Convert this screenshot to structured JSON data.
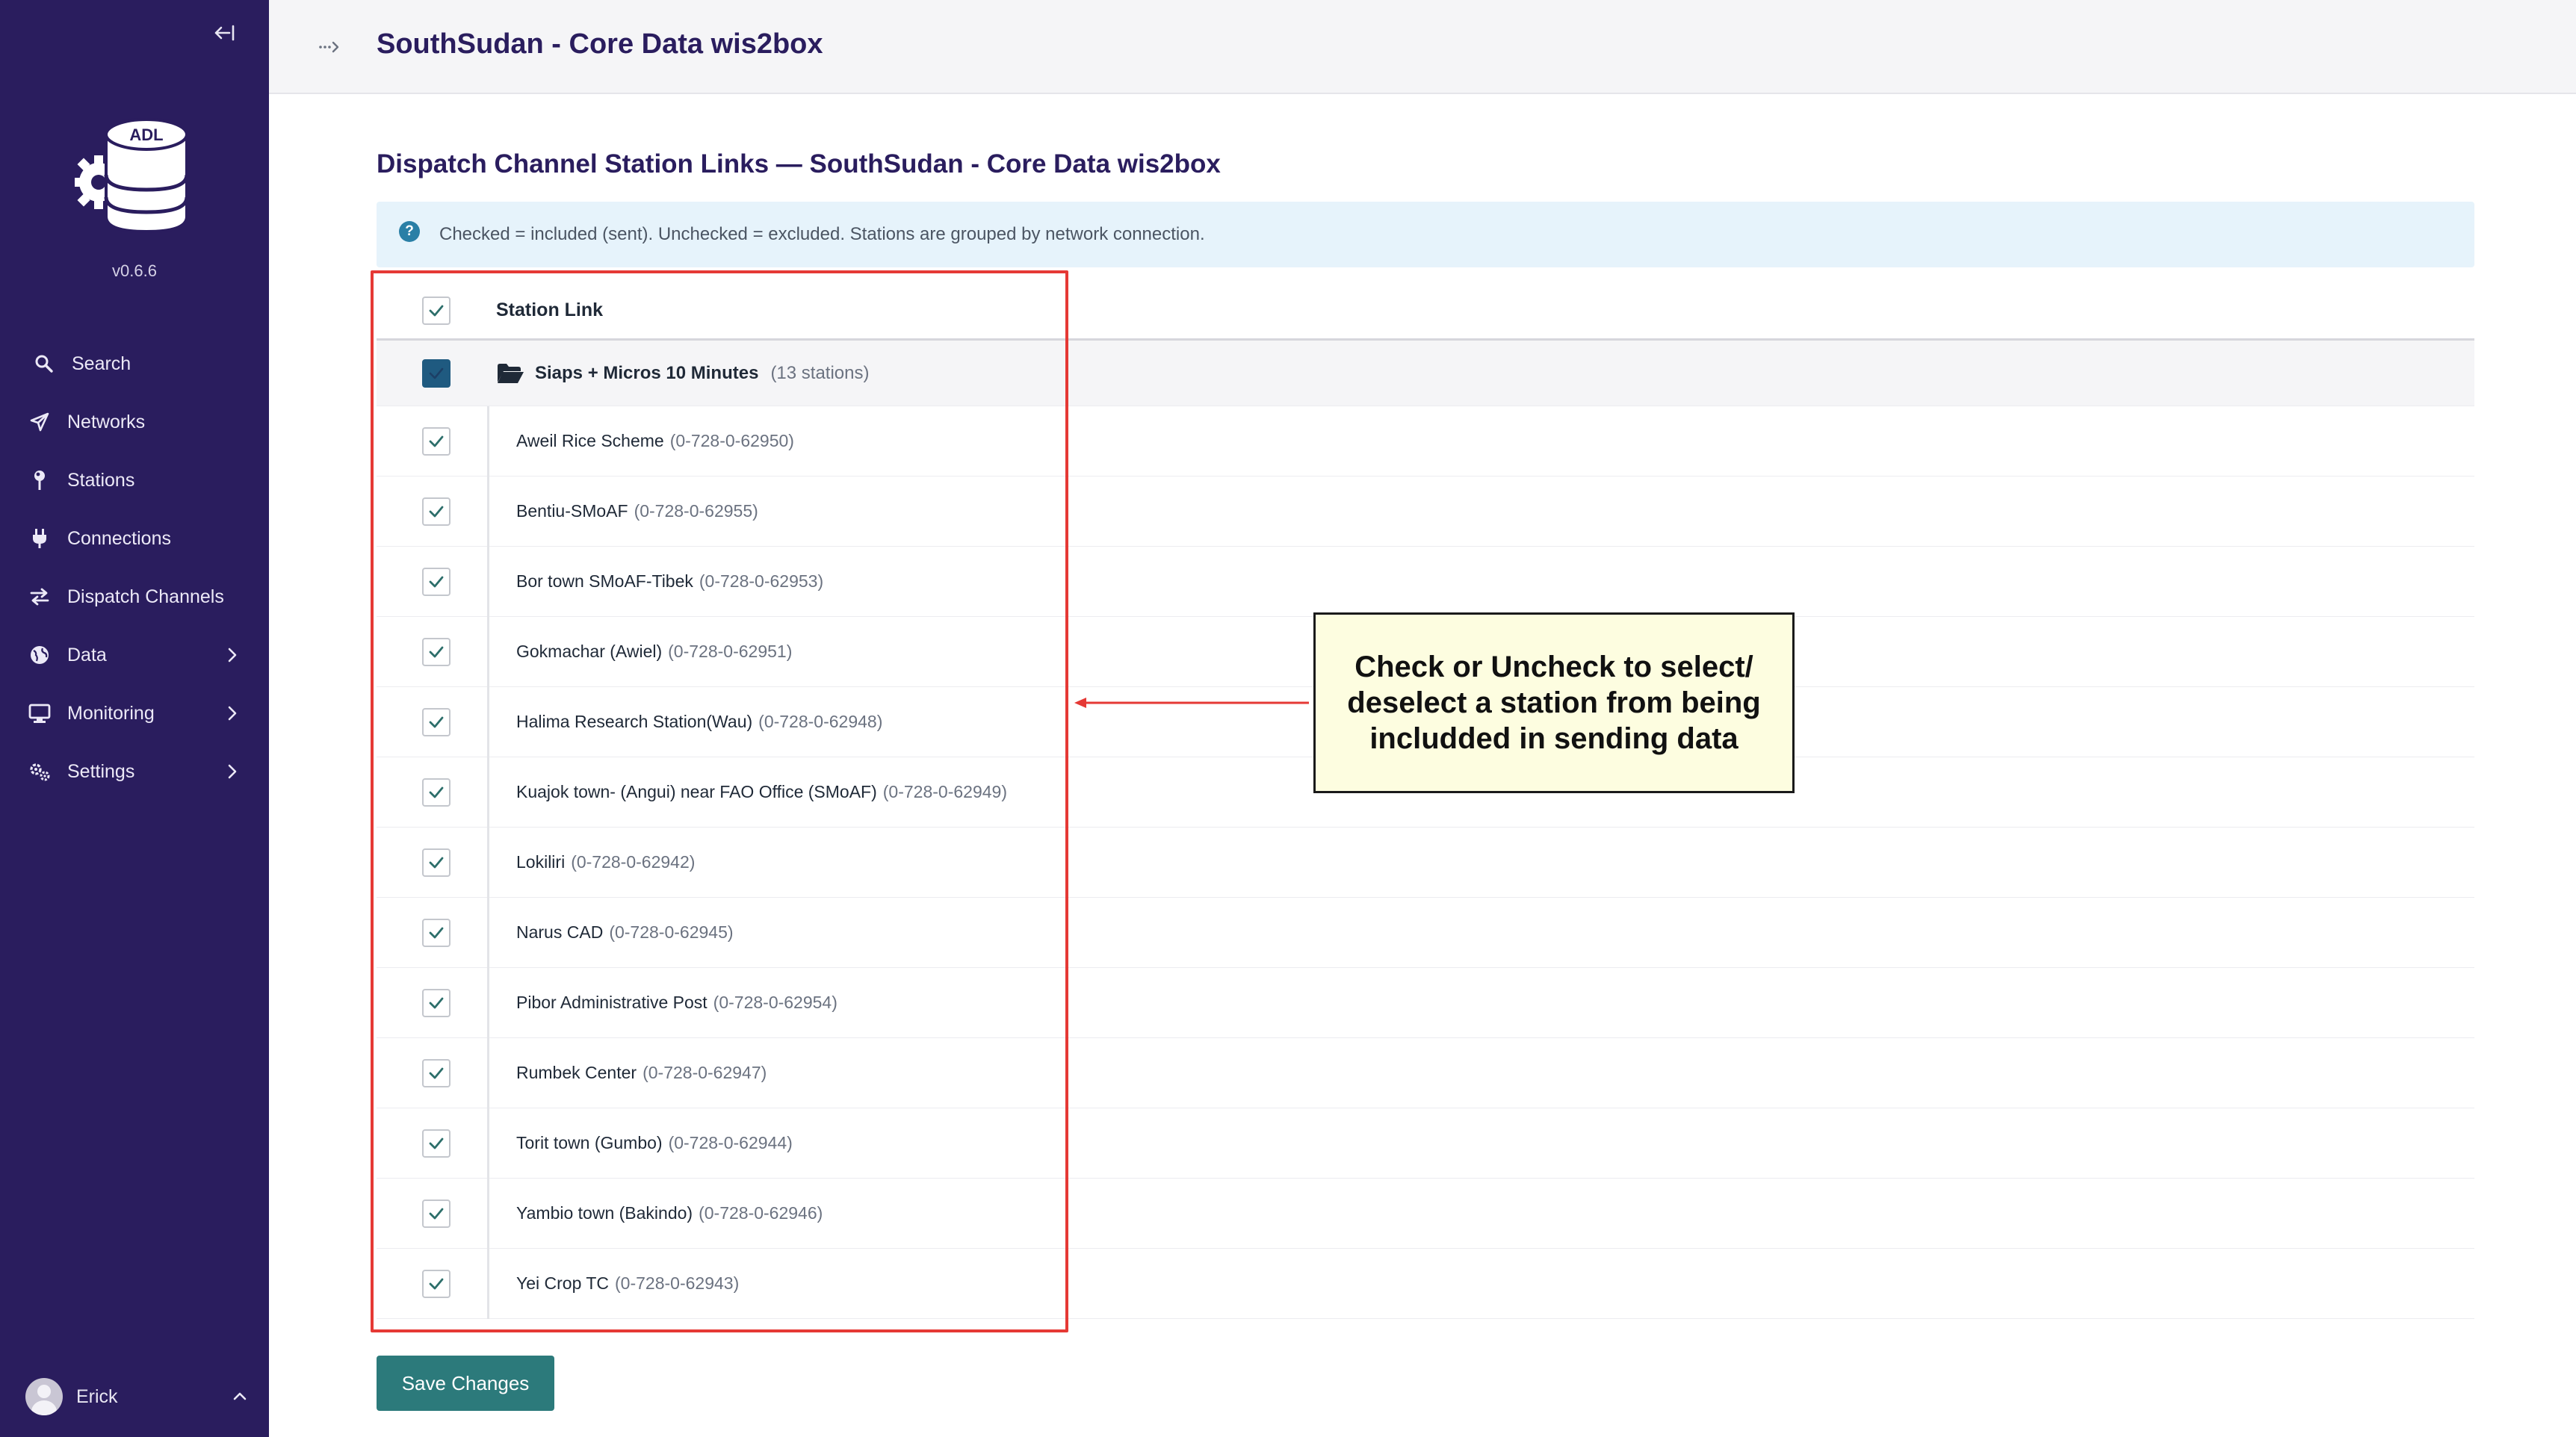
{
  "app": {
    "logo_text": "ADL",
    "version": "v0.6.6"
  },
  "sidebar": {
    "items": [
      {
        "label": "Search",
        "icon": "search-icon",
        "has_submenu": false
      },
      {
        "label": "Networks",
        "icon": "send-icon",
        "has_submenu": false
      },
      {
        "label": "Stations",
        "icon": "pin-icon",
        "has_submenu": false
      },
      {
        "label": "Connections",
        "icon": "plug-icon",
        "has_submenu": false
      },
      {
        "label": "Dispatch Channels",
        "icon": "swap-icon",
        "has_submenu": false
      },
      {
        "label": "Data",
        "icon": "globe-icon",
        "has_submenu": true
      },
      {
        "label": "Monitoring",
        "icon": "monitor-icon",
        "has_submenu": true
      },
      {
        "label": "Settings",
        "icon": "cogs-icon",
        "has_submenu": true
      }
    ],
    "user": {
      "name": "Erick"
    }
  },
  "header": {
    "title": "SouthSudan - Core Data wis2box"
  },
  "main": {
    "title": "Dispatch Channel Station Links — SouthSudan - Core Data wis2box",
    "info": "Checked = included (sent). Unchecked = excluded. Stations are grouped by network connection.",
    "table": {
      "column_header": "Station Link",
      "group": {
        "name": "Siaps + Micros 10 Minutes",
        "count": "(13 stations)",
        "checked": true
      },
      "stations": [
        {
          "name": "Aweil Rice Scheme",
          "id": "(0-728-0-62950)",
          "checked": true
        },
        {
          "name": "Bentiu-SMoAF",
          "id": "(0-728-0-62955)",
          "checked": true
        },
        {
          "name": "Bor town SMoAF-Tibek",
          "id": "(0-728-0-62953)",
          "checked": true
        },
        {
          "name": "Gokmachar (Awiel)",
          "id": "(0-728-0-62951)",
          "checked": true
        },
        {
          "name": "Halima Research Station(Wau)",
          "id": "(0-728-0-62948)",
          "checked": true
        },
        {
          "name": "Kuajok town- (Angui) near FAO Office (SMoAF)",
          "id": "(0-728-0-62949)",
          "checked": true
        },
        {
          "name": "Lokiliri",
          "id": "(0-728-0-62942)",
          "checked": true
        },
        {
          "name": "Narus CAD",
          "id": "(0-728-0-62945)",
          "checked": true
        },
        {
          "name": "Pibor Administrative Post",
          "id": "(0-728-0-62954)",
          "checked": true
        },
        {
          "name": "Rumbek Center",
          "id": "(0-728-0-62947)",
          "checked": true
        },
        {
          "name": "Torit town (Gumbo)",
          "id": "(0-728-0-62944)",
          "checked": true
        },
        {
          "name": "Yambio town (Bakindo)",
          "id": "(0-728-0-62946)",
          "checked": true
        },
        {
          "name": "Yei Crop TC",
          "id": "(0-728-0-62943)",
          "checked": true
        }
      ]
    },
    "save_label": "Save Changes"
  },
  "annotation": {
    "callout_text": "Check or Uncheck to select/ deselect a station from being includded in sending data",
    "highlight_color": "#e53935",
    "callout_bg": "#fdfde0"
  },
  "colors": {
    "sidebar_bg": "#2a1d5e",
    "title_color": "#2a1d5e",
    "checkbox_solid": "#1f5a80",
    "check_mark": "#2c6e6a",
    "save_button": "#2c7a7b",
    "info_bg": "#e6f3fb"
  }
}
